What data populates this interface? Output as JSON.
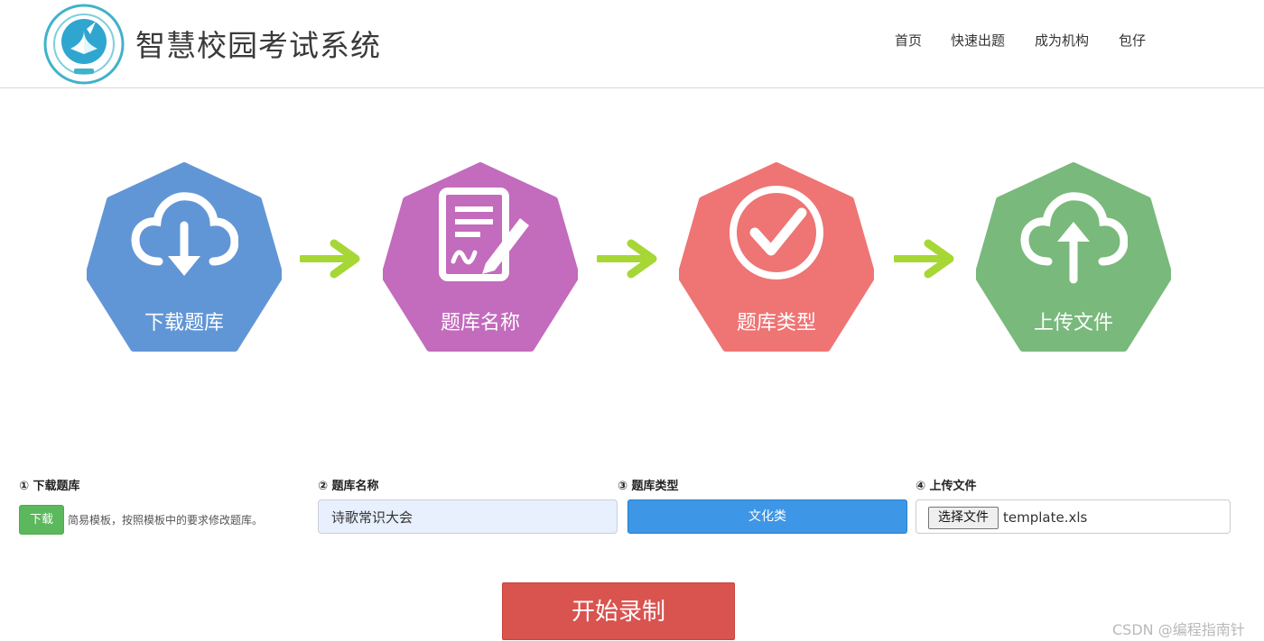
{
  "header": {
    "logo_icon": "school-seal-logo",
    "brand_title": "智慧校园考试系统",
    "nav": [
      {
        "label": "首页"
      },
      {
        "label": "快速出题"
      },
      {
        "label": "成为机构"
      },
      {
        "label": "包仔"
      }
    ]
  },
  "steps": [
    {
      "label": "下载题库",
      "icon": "cloud-download-icon",
      "color": "#6196d6"
    },
    {
      "label": "题库名称",
      "icon": "document-signature-icon",
      "color": "#c36bbd"
    },
    {
      "label": "题库类型",
      "icon": "check-circle-icon",
      "color": "#ef7474"
    },
    {
      "label": "上传文件",
      "icon": "cloud-upload-icon",
      "color": "#79b97c"
    }
  ],
  "arrow_color": "#a6d735",
  "form": {
    "download": {
      "label": "① 下载题库",
      "button": "下载",
      "hint": "简易模板，按照模板中的要求修改题库。"
    },
    "name": {
      "label": "② 题库名称",
      "value": "诗歌常识大会"
    },
    "type": {
      "label": "③ 题库类型",
      "value": "文化类"
    },
    "upload": {
      "label": "④ 上传文件",
      "button": "选择文件",
      "filename": "template.xls"
    }
  },
  "start_button": "开始录制",
  "watermark": "CSDN @编程指南针"
}
